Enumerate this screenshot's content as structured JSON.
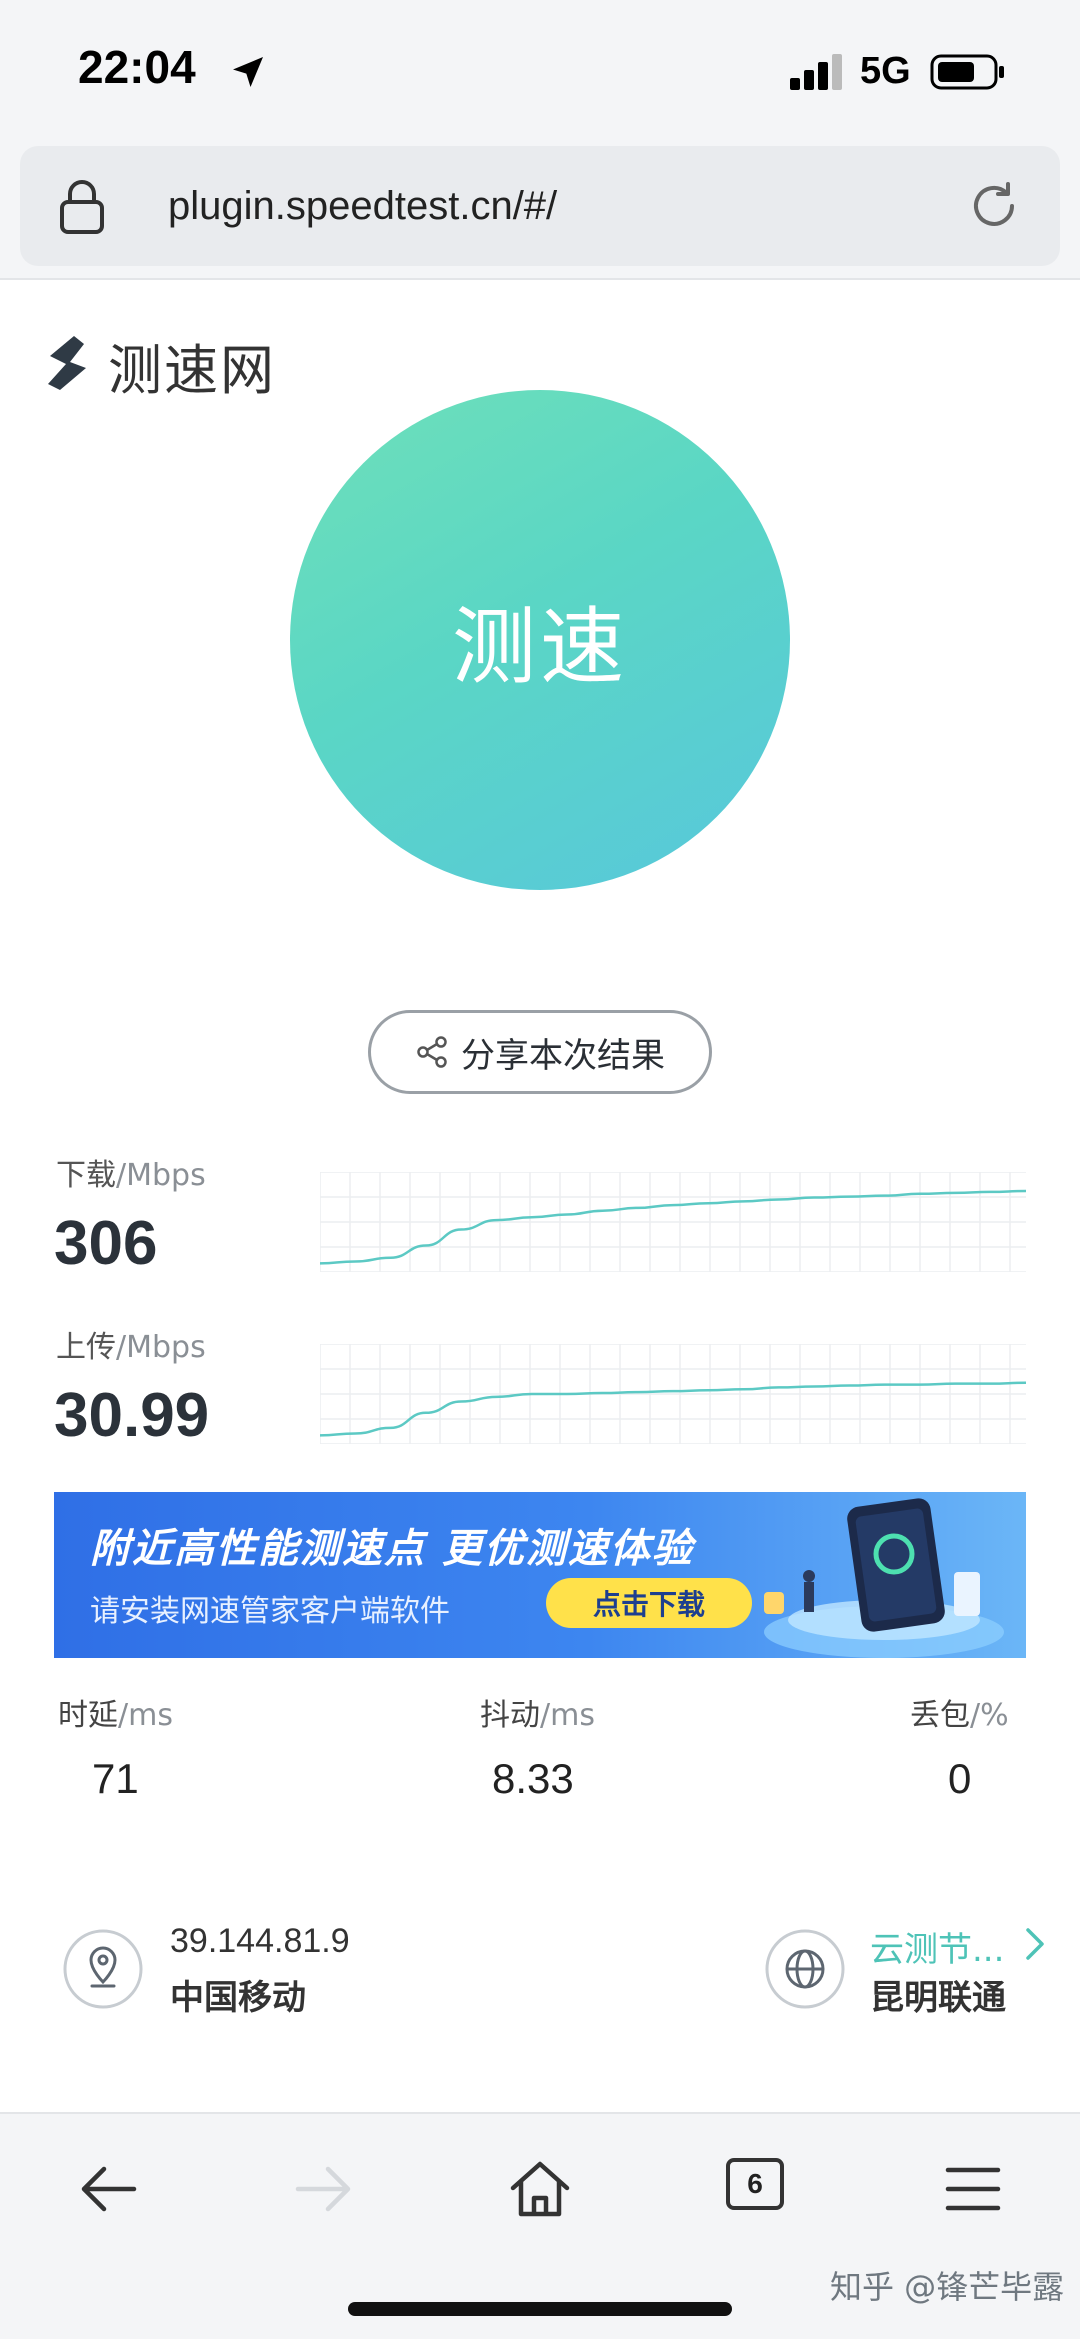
{
  "status_bar": {
    "time": "22:04",
    "network": "5G"
  },
  "browser": {
    "url": "plugin.speedtest.cn/#/"
  },
  "app": {
    "name": "测速网",
    "start_label": "测速",
    "share_label": "分享本次结果"
  },
  "download": {
    "label": "下载",
    "unit": "/Mbps",
    "value": "306",
    "curve": [
      0.06,
      0.08,
      0.12,
      0.25,
      0.42,
      0.52,
      0.55,
      0.58,
      0.62,
      0.65,
      0.68,
      0.7,
      0.72,
      0.74,
      0.76,
      0.77,
      0.78,
      0.8,
      0.81,
      0.82,
      0.83
    ]
  },
  "upload": {
    "label": "上传",
    "unit": "/Mbps",
    "value": "30.99",
    "curve": [
      0.06,
      0.08,
      0.14,
      0.3,
      0.42,
      0.47,
      0.5,
      0.5,
      0.51,
      0.52,
      0.53,
      0.54,
      0.55,
      0.57,
      0.58,
      0.59,
      0.6,
      0.6,
      0.61,
      0.61,
      0.62
    ]
  },
  "banner": {
    "title": "附近高性能测速点 更优测速体验",
    "subtitle": "请安装网速管家客户端软件",
    "button": "点击下载"
  },
  "stats": {
    "latency": {
      "label": "时延",
      "unit": "/ms",
      "value": "71"
    },
    "jitter": {
      "label": "抖动",
      "unit": "/ms",
      "value": "8.33"
    },
    "loss": {
      "label": "丢包",
      "unit": "/%",
      "value": "0"
    }
  },
  "client": {
    "ip": "39.144.81.9",
    "isp": "中国移动"
  },
  "server": {
    "node": "云测节...",
    "isp": "昆明联通"
  },
  "toolbar": {
    "tab_count": "6"
  },
  "watermark": "知乎 @锋芒毕露",
  "colors": {
    "accent": "#5ad6c5",
    "link": "#4ec3b7",
    "banner": "#3d86f0"
  },
  "icons": [
    "location-arrow-icon",
    "signal-icon",
    "battery-icon",
    "lock-icon",
    "reload-icon",
    "share-icon",
    "map-pin-icon",
    "globe-icon",
    "chevron-right-icon",
    "back-arrow-icon",
    "forward-arrow-icon",
    "home-icon",
    "menu-icon"
  ]
}
